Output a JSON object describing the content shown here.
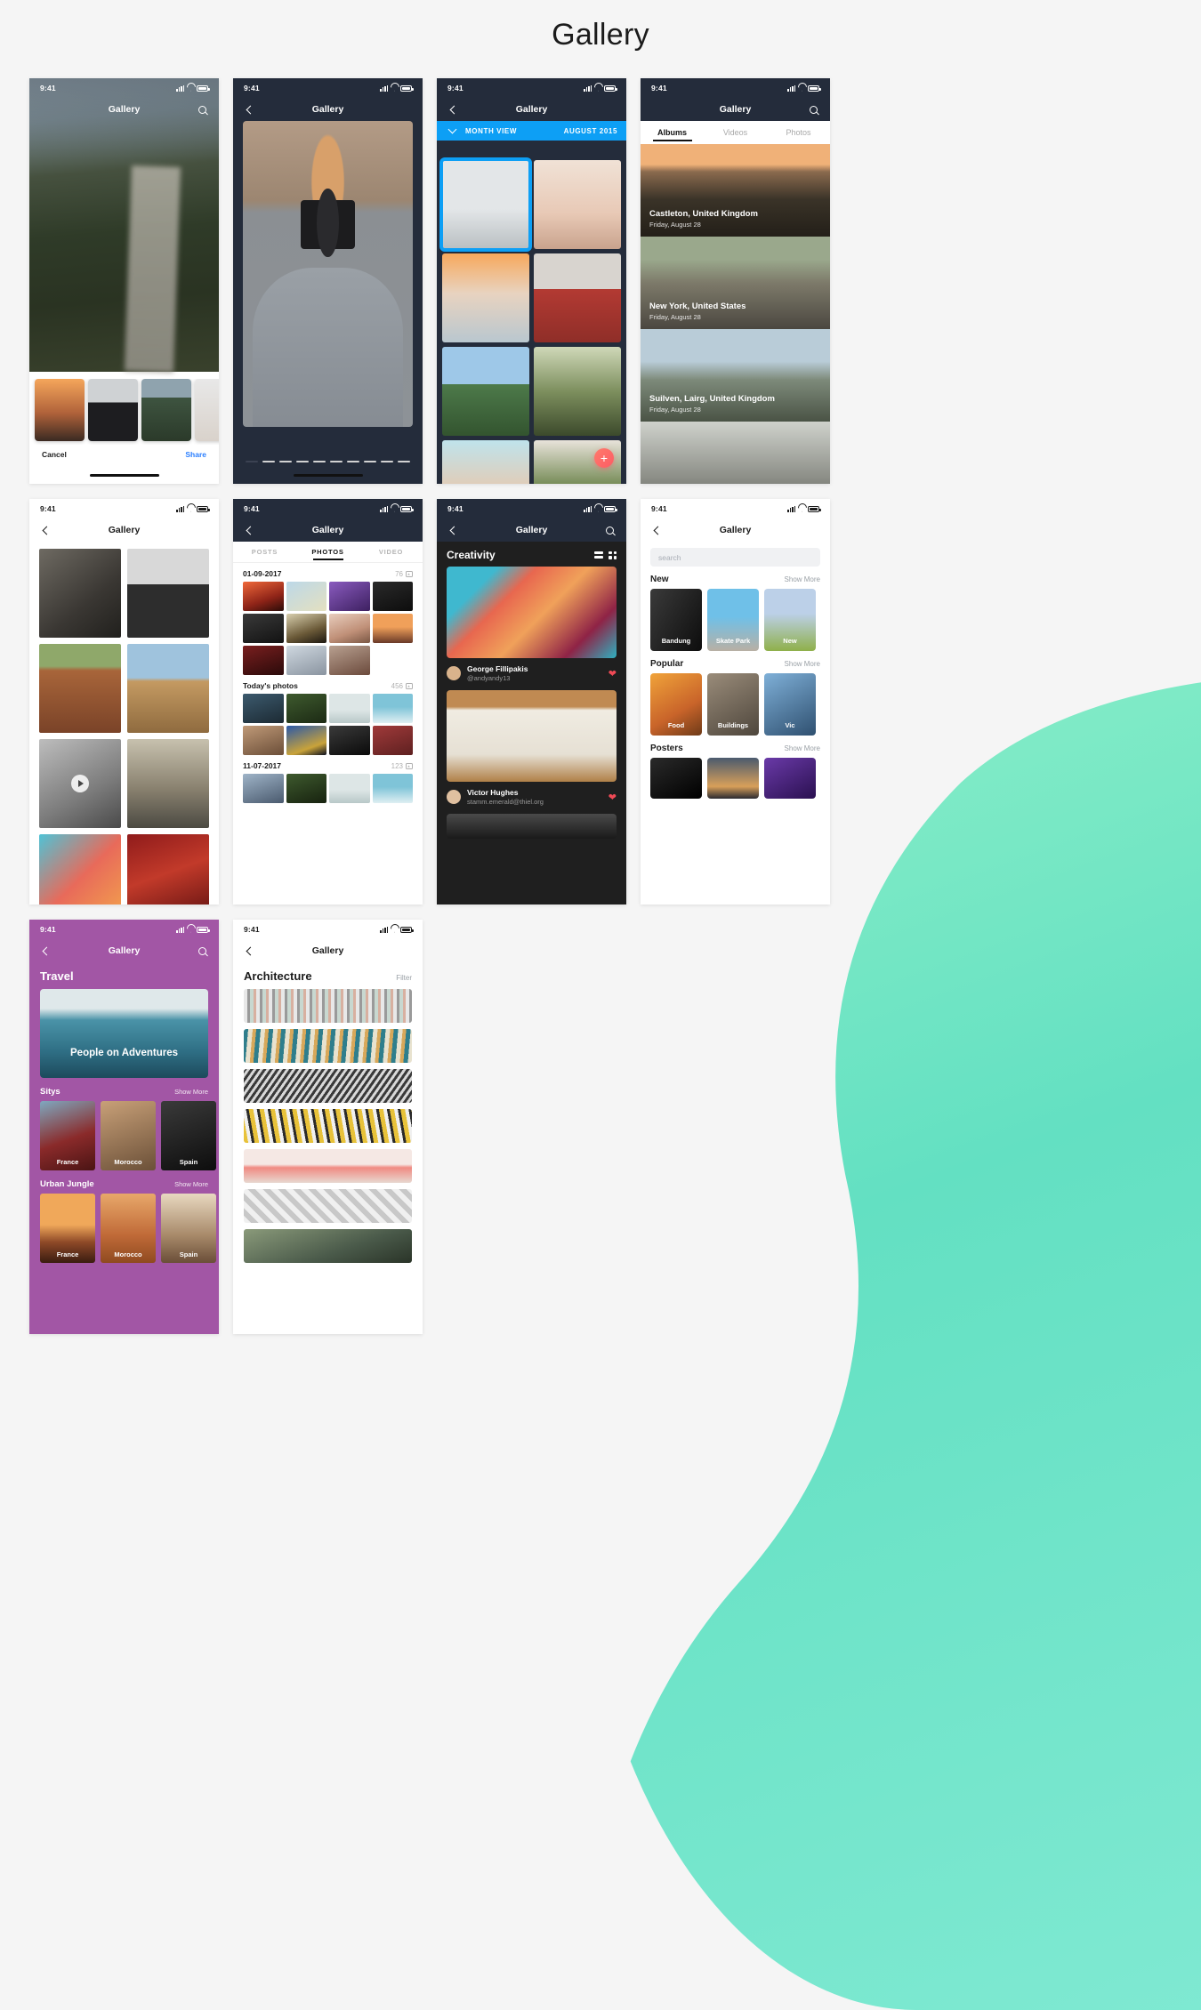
{
  "page": {
    "title": "Gallery"
  },
  "status": {
    "time": "9:41"
  },
  "screens": {
    "s1": {
      "nav_title": "Gallery",
      "menu_icon": "hamburger-icon",
      "search_icon": "search-icon",
      "cancel": "Cancel",
      "share": "Share",
      "share_color": "#2b7fff"
    },
    "s2": {
      "nav_title": "Gallery",
      "back_icon": "chevron-left-icon"
    },
    "s3": {
      "nav_title": "Gallery",
      "month_view": "MONTH VIEW",
      "month_label": "AUGUST 2015",
      "bar_color": "#0d9ff5",
      "fab": "+"
    },
    "s4": {
      "nav_title": "Gallery",
      "tabs": [
        {
          "label": "Albums",
          "active": true
        },
        {
          "label": "Videos",
          "active": false
        },
        {
          "label": "Photos",
          "active": false
        }
      ],
      "albums": [
        {
          "title": "Castleton, United Kingdom",
          "date": "Friday, August 28"
        },
        {
          "title": "New York, United States",
          "date": "Friday, August 28"
        },
        {
          "title": "Suilven, Lairg, United Kingdom",
          "date": "Friday, August 28"
        }
      ]
    },
    "s5": {
      "nav_title": "Gallery"
    },
    "s6": {
      "nav_title": "Gallery",
      "tabs": [
        {
          "label": "POSTS",
          "active": false
        },
        {
          "label": "PHOTOS",
          "active": true
        },
        {
          "label": "VIDEO",
          "active": false
        }
      ],
      "groups": [
        {
          "date": "01-09-2017",
          "count": "76"
        },
        {
          "date": "Today's photos",
          "count": "456"
        },
        {
          "date": "11-07-2017",
          "count": "123"
        }
      ]
    },
    "s7": {
      "nav_title": "Gallery",
      "heading": "Creativity",
      "view_list_icon": "list-view-icon",
      "view_grid_icon": "grid-view-icon",
      "posts": [
        {
          "name": "George Fillipakis",
          "handle": "@andyandy13",
          "like_icon": "heart-icon"
        },
        {
          "name": "Victor Hughes",
          "handle": "stamm.emerald@thiel.org",
          "like_icon": "heart-icon"
        }
      ]
    },
    "s8": {
      "nav_title": "Gallery",
      "search_placeholder": "search",
      "sections": [
        {
          "title": "New",
          "more": "Show More",
          "cards": [
            "Bandung",
            "Skate Park",
            "New"
          ]
        },
        {
          "title": "Popular",
          "more": "Show More",
          "cards": [
            "Food",
            "Buildings",
            "Vic"
          ]
        },
        {
          "title": "Posters",
          "more": "Show More",
          "cards": [
            "",
            "",
            ""
          ]
        }
      ]
    },
    "s9": {
      "nav_title": "Gallery",
      "heading": "Travel",
      "accent": "#a256a5",
      "hero_caption": "People on Adventures",
      "sections": [
        {
          "title": "Sitys",
          "more": "Show More",
          "cards": [
            "France",
            "Morocco",
            "Spain"
          ]
        },
        {
          "title": "Urban Jungle",
          "more": "Show More",
          "cards": [
            "France",
            "Morocco",
            "Spain"
          ]
        }
      ]
    },
    "s10": {
      "nav_title": "Gallery",
      "heading": "Architecture",
      "filter": "Filter"
    }
  }
}
